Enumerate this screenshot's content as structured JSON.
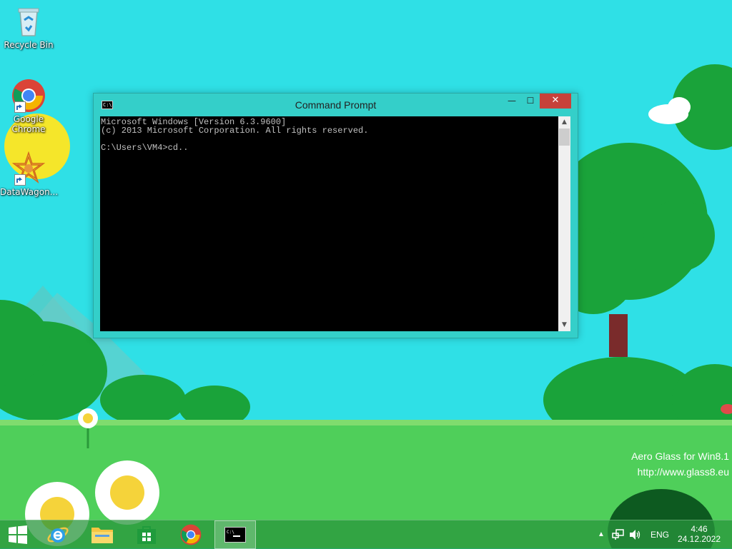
{
  "desktop": {
    "icons": [
      {
        "label": "Recycle Bin",
        "icon": "recycle-bin-icon"
      },
      {
        "label": "Google Chrome",
        "icon": "chrome-icon"
      },
      {
        "label": "DataWagon...",
        "icon": "datawagon-icon"
      }
    ]
  },
  "window": {
    "title": "Command Prompt",
    "controls": {
      "minimize": "—",
      "maximize": "☐",
      "close": "✕"
    },
    "console_lines": [
      "Microsoft Windows [Version 6.3.9600]",
      "(c) 2013 Microsoft Corporation. All rights reserved.",
      "",
      "C:\\Users\\VM4>cd.."
    ],
    "icon_text": "C:\\",
    "scroll": {
      "up": "▲",
      "down": "▼"
    }
  },
  "watermark": {
    "line1": "Aero Glass for Win8.1",
    "line2": "http://www.glass8.eu"
  },
  "taskbar": {
    "items": [
      {
        "name": "start-button",
        "icon": "windows-logo-icon"
      },
      {
        "name": "internet-explorer",
        "icon": "ie-icon"
      },
      {
        "name": "file-explorer",
        "icon": "folder-icon"
      },
      {
        "name": "store",
        "icon": "store-icon"
      },
      {
        "name": "google-chrome",
        "icon": "chrome-icon"
      },
      {
        "name": "command-prompt",
        "icon": "cmd-icon",
        "active": true
      }
    ],
    "tray": {
      "chevron": "▲",
      "language": "ENG",
      "time": "4:46",
      "date": "24.12.2022"
    }
  },
  "colors": {
    "sky": "#2fe0e6",
    "grass": "#4fcf5a",
    "window_frame": "#34cfc9",
    "close_button": "#c7413a",
    "taskbar": "#28963c"
  }
}
